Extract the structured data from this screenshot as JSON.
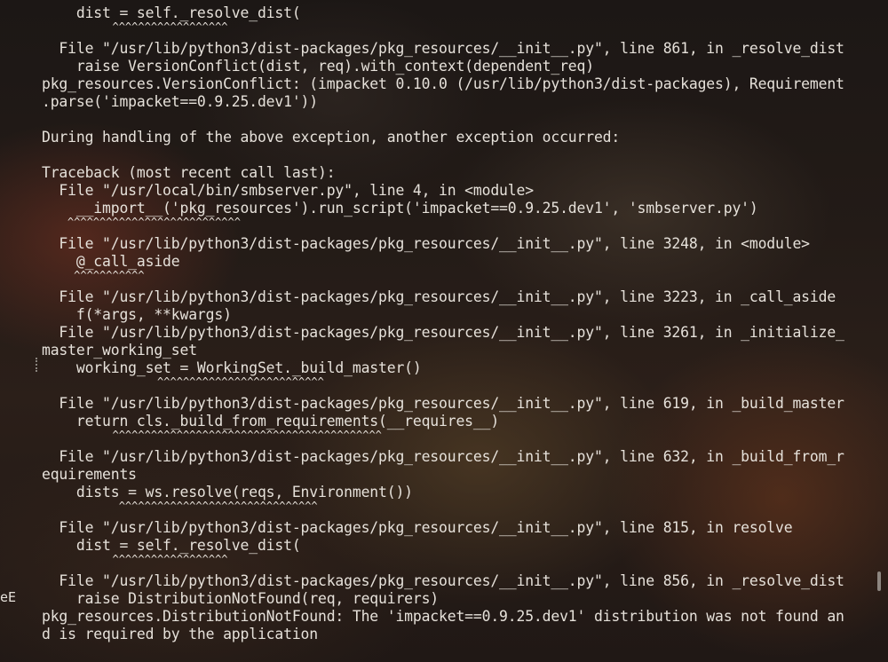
{
  "terminal": {
    "lines": [
      "    dist = self._resolve_dist(",
      "           ^^^^^^^^^^^^^^^^^^",
      "  File \"/usr/lib/python3/dist-packages/pkg_resources/__init__.py\", line 861, in _resolve_dist",
      "    raise VersionConflict(dist, req).with_context(dependent_req)",
      "pkg_resources.VersionConflict: (impacket 0.10.0 (/usr/lib/python3/dist-packages), Requirement",
      ".parse('impacket==0.9.25.dev1'))",
      "",
      "During handling of the above exception, another exception occurred:",
      "",
      "Traceback (most recent call last):",
      "  File \"/usr/local/bin/smbserver.py\", line 4, in <module>",
      "    __import__('pkg_resources').run_script('impacket==0.9.25.dev1', 'smbserver.py')",
      "    ^^^^^^^^^^^^^^^^^^^^^^^^^^^",
      "  File \"/usr/lib/python3/dist-packages/pkg_resources/__init__.py\", line 3248, in <module>",
      "    @_call_aside",
      "     ^^^^^^^^^^^",
      "  File \"/usr/lib/python3/dist-packages/pkg_resources/__init__.py\", line 3223, in _call_aside",
      "    f(*args, **kwargs)",
      "  File \"/usr/lib/python3/dist-packages/pkg_resources/__init__.py\", line 3261, in _initialize_",
      "master_working_set",
      "    working_set = WorkingSet._build_master()",
      "                  ^^^^^^^^^^^^^^^^^^^^^^^^^^",
      "  File \"/usr/lib/python3/dist-packages/pkg_resources/__init__.py\", line 619, in _build_master",
      "    return cls._build_from_requirements(__requires__)",
      "           ^^^^^^^^^^^^^^^^^^^^^^^^^^^^^^^^^^^^^^^^^^",
      "  File \"/usr/lib/python3/dist-packages/pkg_resources/__init__.py\", line 632, in _build_from_r",
      "equirements",
      "    dists = ws.resolve(reqs, Environment())",
      "            ^^^^^^^^^^^^^^^^^^^^^^^^^^^^^^^",
      "  File \"/usr/lib/python3/dist-packages/pkg_resources/__init__.py\", line 815, in resolve",
      "    dist = self._resolve_dist(",
      "           ^^^^^^^^^^^^^^^^^^",
      "  File \"/usr/lib/python3/dist-packages/pkg_resources/__init__.py\", line 856, in _resolve_dist",
      "    raise DistributionNotFound(req, requirers)",
      "pkg_resources.DistributionNotFound: The 'impacket==0.9.25.dev1' distribution was not found an",
      "d is required by the application"
    ],
    "side_mark": "eE"
  }
}
